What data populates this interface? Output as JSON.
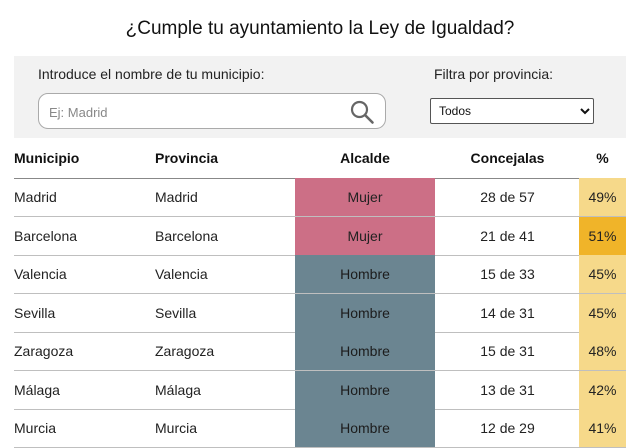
{
  "page": {
    "title": "¿Cumple tu ayuntamiento la Ley de Igualdad?"
  },
  "filters": {
    "search_label": "Introduce el nombre de tu municipio:",
    "search_placeholder": "Ej: Madrid",
    "search_icon": "search-icon",
    "province_label": "Filtra por provincia:",
    "province_selected": "Todos"
  },
  "table": {
    "headers": {
      "municipio": "Municipio",
      "provincia": "Provincia",
      "alcalde": "Alcalde",
      "concejalas": "Concejalas",
      "pct": "%"
    },
    "colors": {
      "mujer": "#cc6f86",
      "hombre": "#6b8591",
      "pct_light": "#f6d98a",
      "pct_dark": "#f0b429"
    },
    "rows": [
      {
        "municipio": "Madrid",
        "provincia": "Madrid",
        "alcalde": "Mujer",
        "concejalas": "28 de 57",
        "pct": "49%"
      },
      {
        "municipio": "Barcelona",
        "provincia": "Barcelona",
        "alcalde": "Mujer",
        "concejalas": "21 de 41",
        "pct": "51%"
      },
      {
        "municipio": "Valencia",
        "provincia": "Valencia",
        "alcalde": "Hombre",
        "concejalas": "15 de 33",
        "pct": "45%"
      },
      {
        "municipio": "Sevilla",
        "provincia": "Sevilla",
        "alcalde": "Hombre",
        "concejalas": "14 de 31",
        "pct": "45%"
      },
      {
        "municipio": "Zaragoza",
        "provincia": "Zaragoza",
        "alcalde": "Hombre",
        "concejalas": "15 de 31",
        "pct": "48%"
      },
      {
        "municipio": "Málaga",
        "provincia": "Málaga",
        "alcalde": "Hombre",
        "concejalas": "13 de 31",
        "pct": "42%"
      },
      {
        "municipio": "Murcia",
        "provincia": "Murcia",
        "alcalde": "Hombre",
        "concejalas": "12 de 29",
        "pct": "41%"
      }
    ]
  }
}
